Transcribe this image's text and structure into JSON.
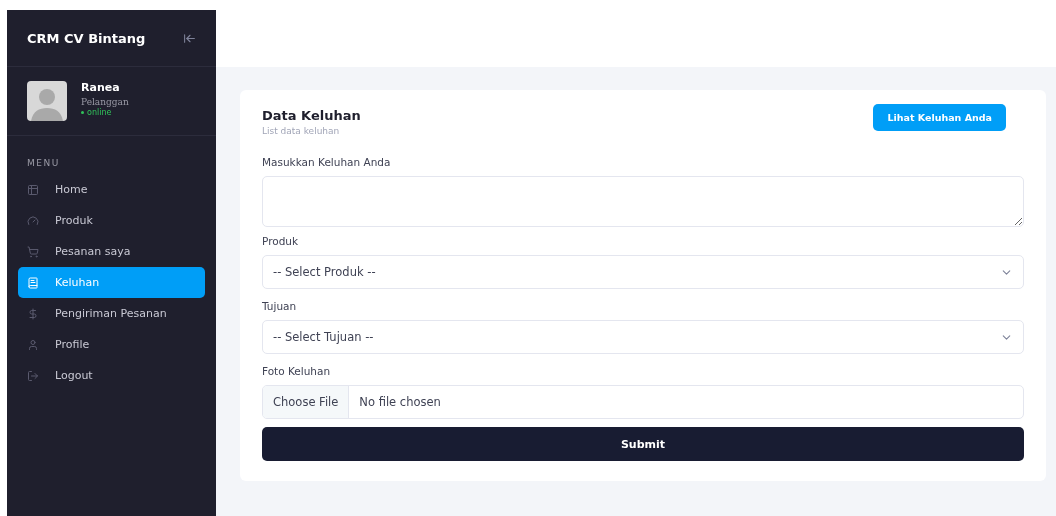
{
  "sidebar": {
    "title": "CRM CV Bintang",
    "user": {
      "name": "Ranea",
      "role": "Pelanggan",
      "status": "online"
    },
    "menu_heading": "MENU",
    "items": [
      {
        "label": "Home",
        "selected": false
      },
      {
        "label": "Produk",
        "selected": false
      },
      {
        "label": "Pesanan saya",
        "selected": false
      },
      {
        "label": "Keluhan",
        "selected": true
      },
      {
        "label": "Pengiriman Pesanan",
        "selected": false
      },
      {
        "label": "Profile",
        "selected": false
      },
      {
        "label": "Logout",
        "selected": false
      }
    ]
  },
  "card": {
    "title": "Data Keluhan",
    "subtitle": "List data keluhan",
    "action_button": "Lihat Keluhan Anda",
    "fields": [
      {
        "kind": "textarea",
        "label": "Masukkan Keluhan Anda"
      },
      {
        "kind": "select",
        "label": "Produk",
        "value": "-- Select Produk --"
      },
      {
        "kind": "select",
        "label": "Tujuan",
        "value": "-- Select Tujuan --"
      },
      {
        "kind": "file",
        "label": "Foto Keluhan",
        "button": "Choose File",
        "value": "No file chosen"
      }
    ],
    "submit": "Submit"
  }
}
